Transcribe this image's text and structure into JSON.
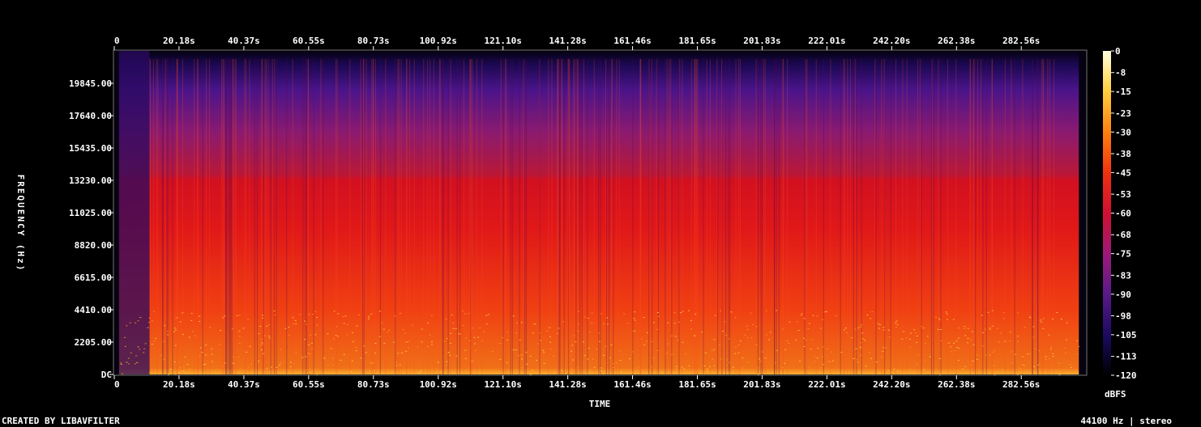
{
  "chart_data": {
    "type": "heatmap",
    "subtype": "spectrogram",
    "xlabel": "TIME",
    "ylabel": "FREQUENCY (Hz)",
    "x_unit": "s",
    "x_ticks": [
      "0",
      "20.18s",
      "40.37s",
      "60.55s",
      "80.73s",
      "100.92s",
      "121.10s",
      "141.28s",
      "161.46s",
      "181.65s",
      "201.83s",
      "222.01s",
      "242.20s",
      "262.38s",
      "282.56s"
    ],
    "x_tick_values": [
      0,
      20.18,
      40.37,
      60.55,
      80.73,
      100.92,
      121.1,
      141.28,
      161.46,
      181.65,
      201.83,
      222.01,
      242.2,
      262.38,
      282.56
    ],
    "y_ticks": [
      "DC",
      "2205.00",
      "4410.00",
      "6615.00",
      "8820.00",
      "11025.00",
      "13230.00",
      "15435.00",
      "17640.00",
      "19845.00"
    ],
    "y_tick_values": [
      0,
      2205,
      4410,
      6615,
      8820,
      11025,
      13230,
      15435,
      17640,
      19845
    ],
    "xlim": [
      0,
      302.7
    ],
    "ylim": [
      0,
      22050
    ],
    "colorbar": {
      "label": "dBFS",
      "ticks": [
        "0",
        "-8",
        "-15",
        "-23",
        "-30",
        "-38",
        "-45",
        "-53",
        "-60",
        "-68",
        "-75",
        "-83",
        "-90",
        "-98",
        "-105",
        "-113",
        "-120"
      ],
      "range": [
        -120,
        0
      ],
      "colormap": [
        "#000000",
        "#1a0a5e",
        "#5a1a8a",
        "#9a1a7a",
        "#d01030",
        "#f03010",
        "#ff8010",
        "#ffd040",
        "#ffffe0"
      ]
    },
    "energy_profile": {
      "quiet_intervals_s": [
        [
          0,
          1.5
        ],
        [
          300.5,
          302.7
        ]
      ],
      "sparse_intro_s": [
        1.5,
        11
      ],
      "high_freq_rolloff_hz": 13230,
      "bright_low_band_hz": [
        0,
        4410
      ]
    }
  },
  "footer": {
    "created_by": "CREATED BY LIBAVFILTER",
    "audio_info": "44100 Hz | stereo"
  }
}
